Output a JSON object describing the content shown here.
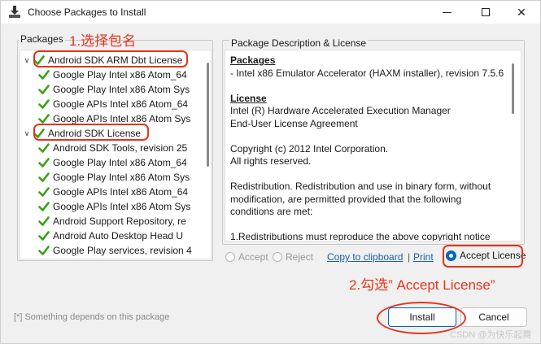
{
  "window": {
    "title": "Choose Packages to Install",
    "min_icon": "minimize-icon",
    "max_icon": "maximize-icon",
    "close_icon": "close-icon",
    "close_glyph": "✕"
  },
  "packages": {
    "legend": "Packages",
    "tree": [
      {
        "label": "Android SDK ARM Dbt License",
        "level": 0,
        "expanded": true
      },
      {
        "label": "Google Play Intel x86 Atom_64",
        "level": 1
      },
      {
        "label": "Google Play Intel x86 Atom Sys",
        "level": 1
      },
      {
        "label": "Google APIs Intel x86 Atom_64",
        "level": 1
      },
      {
        "label": "Google APIs Intel x86 Atom Sys",
        "level": 1
      },
      {
        "label": "Android SDK License",
        "level": 0,
        "expanded": true
      },
      {
        "label": "Android SDK Tools, revision 25",
        "level": 1
      },
      {
        "label": "Google Play Intel x86 Atom_64",
        "level": 1
      },
      {
        "label": "Google Play Intel x86 Atom Sys",
        "level": 1
      },
      {
        "label": "Google APIs Intel x86 Atom_64",
        "level": 1
      },
      {
        "label": "Google APIs Intel x86 Atom Sys",
        "level": 1
      },
      {
        "label": "Android Support Repository, re",
        "level": 1
      },
      {
        "label": "Android Auto Desktop Head U",
        "level": 1
      },
      {
        "label": "Google Play services, revision 4",
        "level": 1
      }
    ]
  },
  "description": {
    "legend": "Package Description & License",
    "lines": [
      {
        "text": "Packages",
        "head": true
      },
      {
        "text": "- Intel x86 Emulator Accelerator (HAXM installer), revision 7.5.6"
      },
      {
        "text": ""
      },
      {
        "text": "License",
        "head": true
      },
      {
        "text": "Intel (R) Hardware Accelerated Execution Manager"
      },
      {
        "text": "End-User License Agreement"
      },
      {
        "text": ""
      },
      {
        "text": "Copyright (c) 2012 Intel Corporation."
      },
      {
        "text": "All rights reserved."
      },
      {
        "text": ""
      },
      {
        "text": "Redistribution. Redistribution and use in binary form, without"
      },
      {
        "text": "modification, are permitted provided that the following"
      },
      {
        "text": "conditions are met:"
      },
      {
        "text": ""
      },
      {
        "text": "1.Redistributions must reproduce the above copyright notice"
      }
    ]
  },
  "controls": {
    "accept": "Accept",
    "reject": "Reject",
    "copy_link": "Copy to clipboard",
    "separator": "|",
    "print_link": "Print",
    "accept_license": "Accept License",
    "accept_license_selected": true
  },
  "footer_note": "[*] Something depends on this package",
  "buttons": {
    "install": "Install",
    "cancel": "Cancel"
  },
  "annotations": {
    "step1": "1.选择包名",
    "step2": "2.勾选” Accept License”",
    "watermark": "CSDN @为快乐起舞"
  },
  "colors": {
    "check": "#3aa017",
    "accent": "#0067c0",
    "annotation": "#e5341c",
    "link": "#1a5fb4"
  }
}
